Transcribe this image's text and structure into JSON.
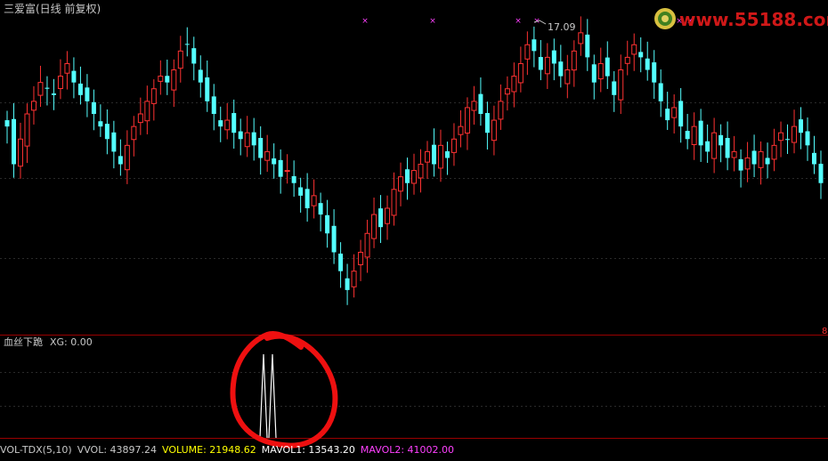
{
  "header": {
    "title": "三爱富(日线 前复权)",
    "peak_price": "17.09",
    "edge_mark": "8"
  },
  "indicator": {
    "name": "血丝下跪",
    "value": "XG: 0.00"
  },
  "volume_bar": {
    "name": "VOL-TDX(5,10)",
    "vvol": "VVOL: 43897.24",
    "volume": "VOLUME: 21948.62",
    "mavol1": "MAVOL1: 13543.20",
    "mavol2": "MAVOL2: 41002.00"
  },
  "watermark": {
    "text": "www.55188.com"
  },
  "colors": {
    "up": "#ff3232",
    "down": "#54ffff",
    "signal": "#ffffff",
    "volume": "#ffff00",
    "mavol1": "#ffffff",
    "mavol2": "#ff40ff",
    "circle": "#ee1010",
    "marker": "#ff40ff"
  },
  "chart_data": {
    "type": "candlestick",
    "closes": [
      15.6,
      15.0,
      15.4,
      15.8,
      16.0,
      16.3,
      16.2,
      16.1,
      16.4,
      16.6,
      16.3,
      16.1,
      16.0,
      15.8,
      15.6,
      15.4,
      15.2,
      15.0,
      15.3,
      15.6,
      15.8,
      16.0,
      16.2,
      16.4,
      16.3,
      16.5,
      16.8,
      16.9,
      16.6,
      16.3,
      16.0,
      15.8,
      15.6,
      15.7,
      15.5,
      15.4,
      15.5,
      15.3,
      15.1,
      15.2,
      15.0,
      14.8,
      14.9,
      14.7,
      14.5,
      14.3,
      14.5,
      14.2,
      13.9,
      13.6,
      13.3,
      13.0,
      13.3,
      13.6,
      13.9,
      14.2,
      14.0,
      14.3,
      14.6,
      14.8,
      14.7,
      14.9,
      15.0,
      15.2,
      15.0,
      15.3,
      15.1,
      15.4,
      15.6,
      15.9,
      16.0,
      15.8,
      15.5,
      15.7,
      16.0,
      16.2,
      16.4,
      16.6,
      16.9,
      16.8,
      16.5,
      16.7,
      16.6,
      16.4,
      16.5,
      16.8,
      17.09,
      16.7,
      16.3,
      16.6,
      16.4,
      16.1,
      16.5,
      16.7,
      16.9,
      16.7,
      16.5,
      16.3,
      16.0,
      15.7,
      15.9,
      15.6,
      15.4,
      15.6,
      15.3,
      15.2,
      15.5,
      15.3,
      15.1,
      15.2,
      14.9,
      15.1,
      15.0,
      15.2,
      15.0,
      15.3,
      15.5,
      15.4,
      15.6,
      15.5,
      15.3,
      15.0,
      14.7
    ]
  }
}
